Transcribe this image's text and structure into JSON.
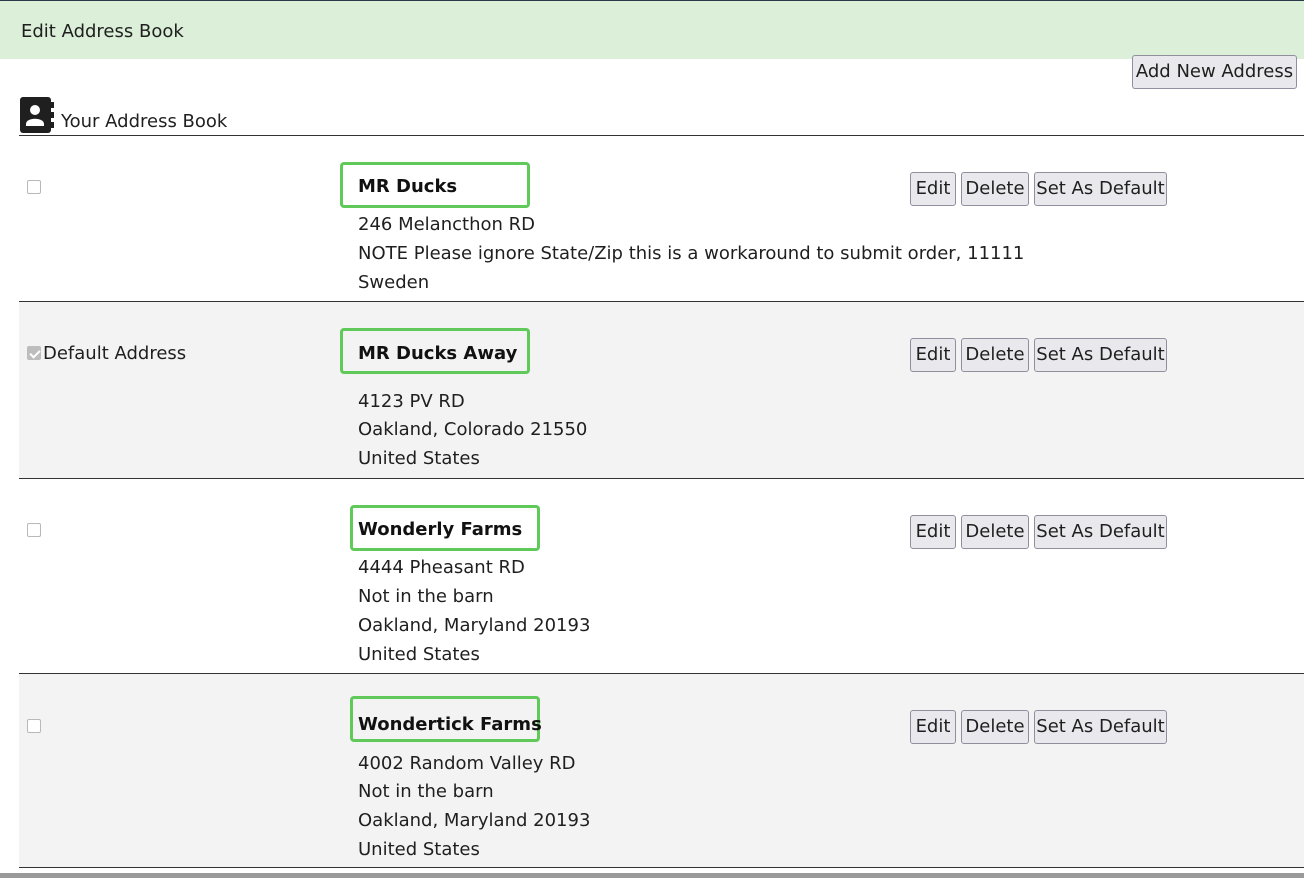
{
  "header": {
    "title": "Edit Address Book"
  },
  "toolbar": {
    "add_label": "Add New Address"
  },
  "book": {
    "label": "Your Address Book",
    "icon": "address-book-icon"
  },
  "buttons": {
    "edit": "Edit",
    "delete": "Delete",
    "set_default": "Set As Default"
  },
  "default_label": "Default Address",
  "colors": {
    "header_bg": "#dcefd8",
    "highlight": "#5fc95a",
    "row_alt": "#f3f3f3"
  },
  "addresses": [
    {
      "name": "MR Ducks",
      "lines": [
        "246 Melancthon RD",
        "NOTE Please ignore State/Zip this is a workaround to submit order, 11111",
        "Sweden"
      ],
      "is_default": false
    },
    {
      "name": "MR Ducks Away",
      "lines": [
        "4123 PV RD",
        "Oakland, Colorado 21550",
        "United States"
      ],
      "is_default": true
    },
    {
      "name": "Wonderly Farms",
      "lines": [
        "4444 Pheasant RD",
        "Not in the barn",
        "Oakland, Maryland 20193",
        "United States"
      ],
      "is_default": false
    },
    {
      "name": "Wondertick Farms",
      "lines": [
        "4002 Random Valley RD",
        "Not in the barn",
        "Oakland, Maryland 20193",
        "United States"
      ],
      "is_default": false
    }
  ]
}
